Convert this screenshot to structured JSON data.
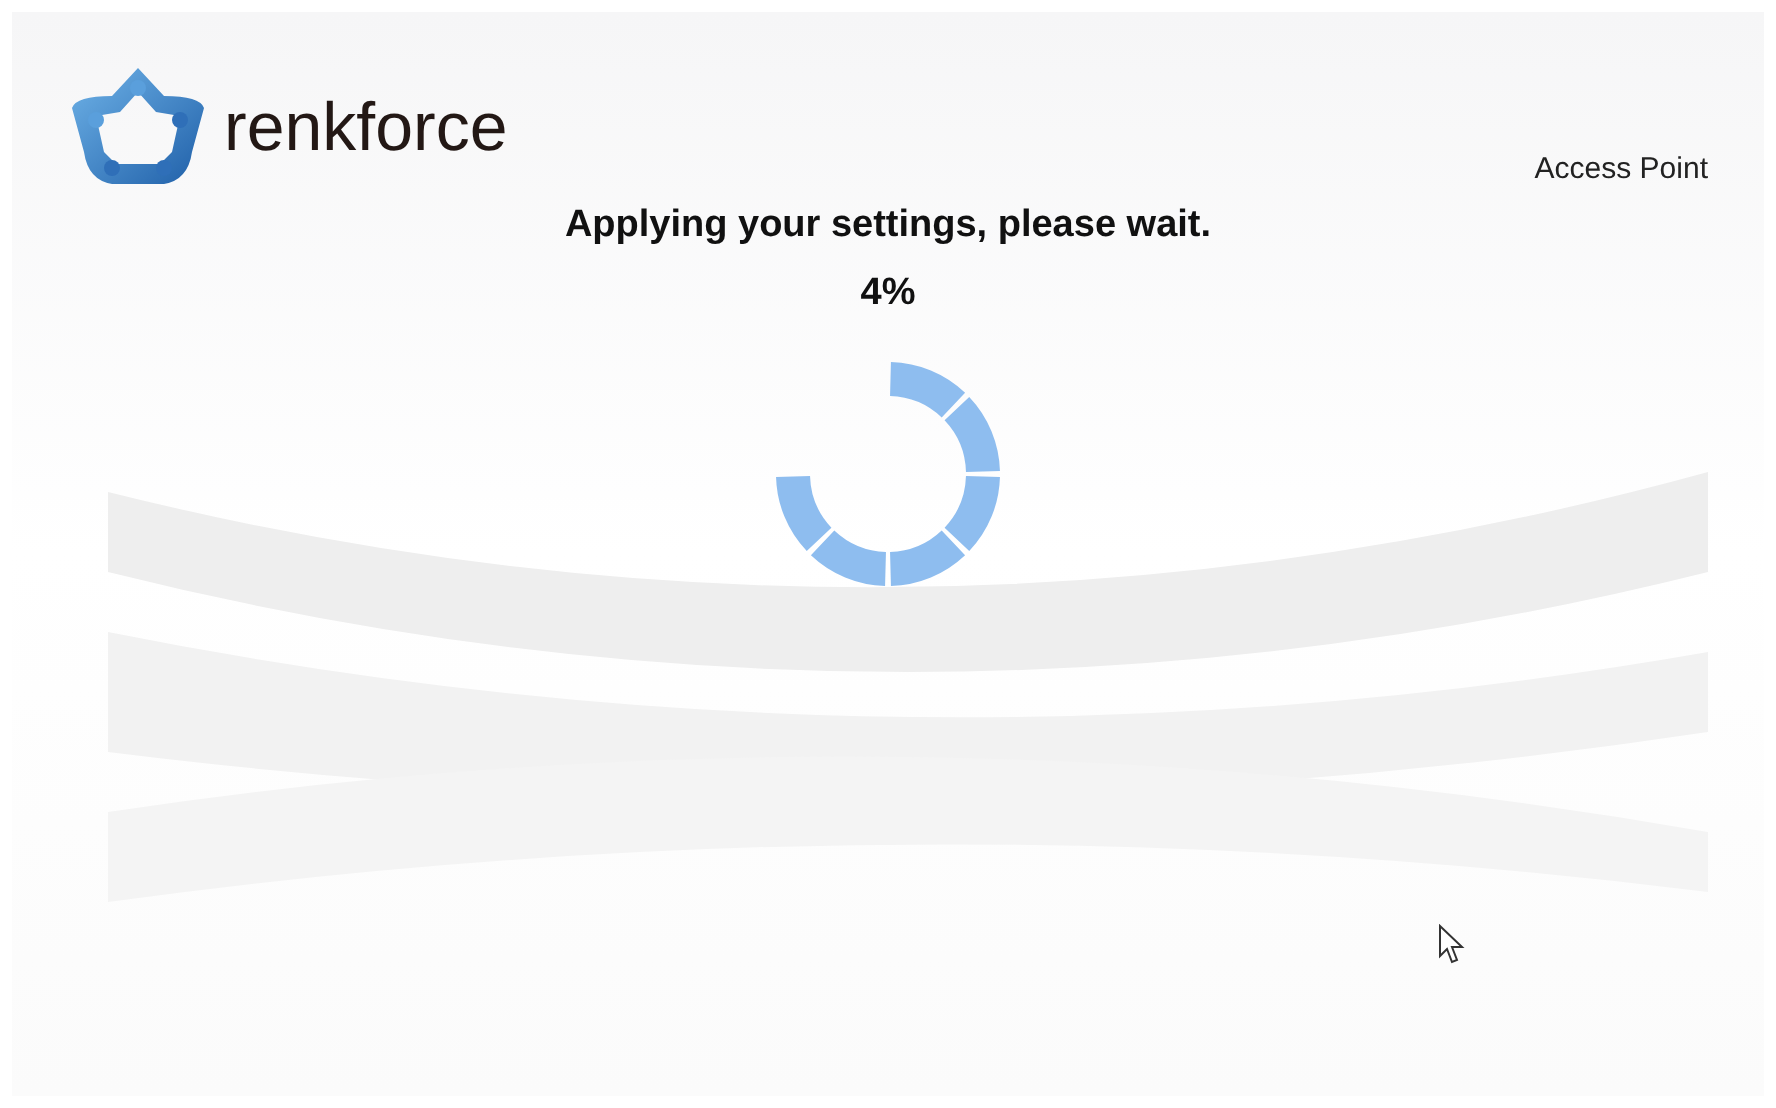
{
  "header": {
    "brand": "renkforce",
    "mode": "Access Point"
  },
  "progress": {
    "message": "Applying your settings, please wait.",
    "percent": "4%"
  }
}
